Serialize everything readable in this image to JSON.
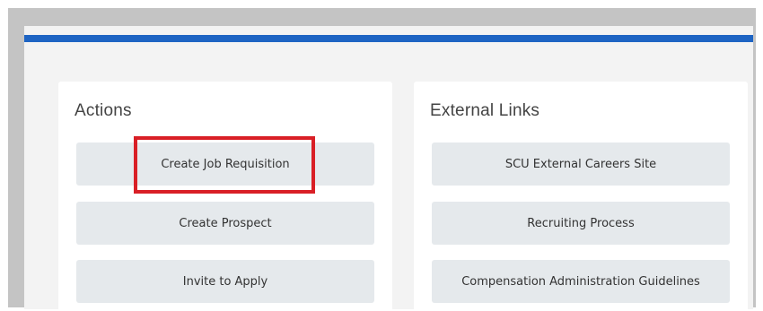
{
  "actions": {
    "title": "Actions",
    "buttons": [
      "Create Job Requisition",
      "Create Prospect",
      "Invite to Apply"
    ]
  },
  "external_links": {
    "title": "External Links",
    "buttons": [
      "SCU External Careers Site",
      "Recruiting Process",
      "Compensation Administration Guidelines"
    ]
  },
  "colors": {
    "accent_bar": "#1e64c3",
    "highlight_box": "#d91f26",
    "button_bg": "#e5e9ec"
  }
}
